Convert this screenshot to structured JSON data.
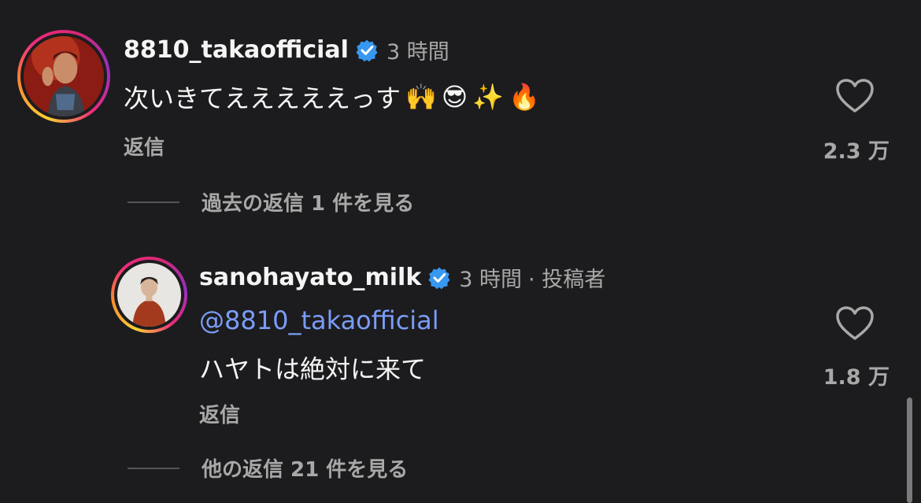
{
  "comments": [
    {
      "username": "8810_takaofficial",
      "verified": true,
      "time": "3 時間",
      "author_tag": "",
      "text": "次いきてえええええっす",
      "emojis": [
        "🙌",
        "😎",
        "✨",
        "🔥"
      ],
      "reply_label": "返信",
      "likes": "2.3 万",
      "view_replies": "過去の返信 1 件を見る"
    },
    {
      "username": "sanohayato_milk",
      "verified": true,
      "time": "3 時間",
      "author_tag": "· 投稿者",
      "mention": "@8810_takaofficial",
      "text": "ハヤトは絶対に来て",
      "reply_label": "返信",
      "likes": "1.8 万",
      "view_replies": "他の返信 21 件を見る"
    }
  ],
  "icons": {
    "verified": "verified-badge-icon",
    "like": "heart-outline-icon"
  },
  "colors": {
    "background": "#1c1c1e",
    "mention": "#7b9cf7",
    "verified": "#3897f0",
    "muted": "#a8a8a8"
  }
}
